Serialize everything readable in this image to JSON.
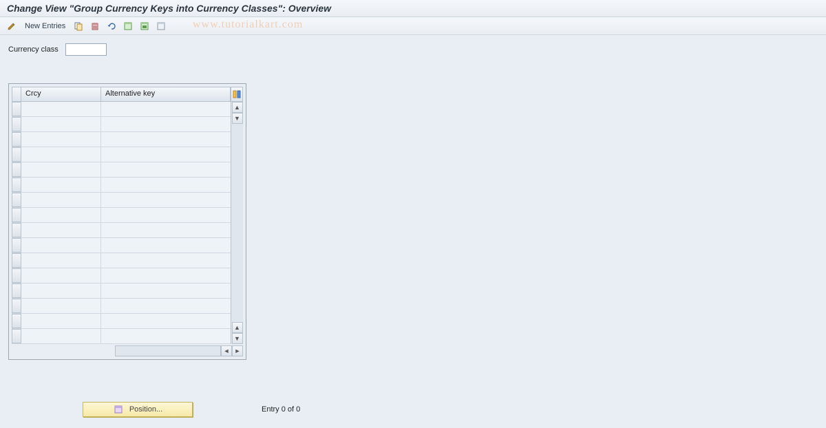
{
  "title": "Change View \"Group Currency Keys into Currency Classes\": Overview",
  "toolbar": {
    "new_entries": "New Entries"
  },
  "watermark": "www.tutorialkart.com",
  "form": {
    "currency_class_label": "Currency class",
    "currency_class_value": ""
  },
  "table": {
    "col_crcy": "Crcy",
    "col_alt": "Alternative key",
    "row_count": 16
  },
  "footer": {
    "position_label": "Position...",
    "entry_label": "Entry 0 of 0"
  }
}
